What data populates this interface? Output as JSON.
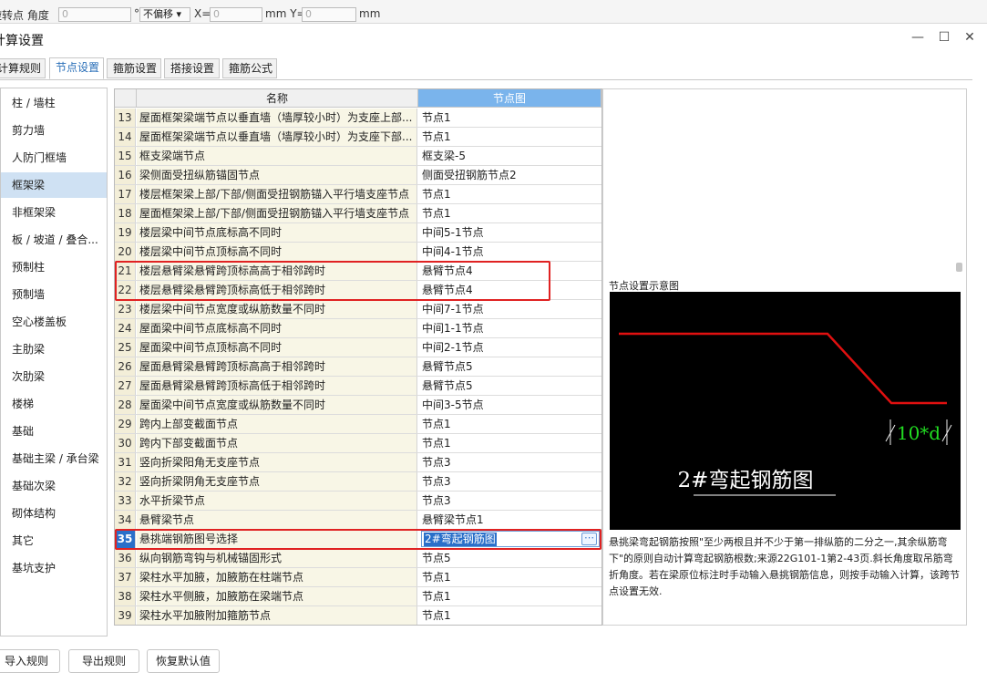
{
  "topstrip": {
    "label_rotate": "旋转点 角度",
    "angle_value": "0",
    "degree_unit": "°",
    "offset_mode": "不偏移",
    "x_label": "X=",
    "x_value": "0",
    "y_label": "mm Y=",
    "y_value": "0",
    "mm_unit": "mm"
  },
  "window": {
    "title": "计算设置",
    "minimize": "—",
    "maximize": "☐",
    "close": "✕"
  },
  "tabs": [
    {
      "label": "计算规则",
      "active": false
    },
    {
      "label": "节点设置",
      "active": true
    },
    {
      "label": "箍筋设置",
      "active": false
    },
    {
      "label": "搭接设置",
      "active": false
    },
    {
      "label": "箍筋公式",
      "active": false
    }
  ],
  "categories": [
    {
      "label": "柱 / 墙柱",
      "selected": false
    },
    {
      "label": "剪力墙",
      "selected": false
    },
    {
      "label": "人防门框墙",
      "selected": false
    },
    {
      "label": "框架梁",
      "selected": true
    },
    {
      "label": "非框架梁",
      "selected": false
    },
    {
      "label": "板 / 坡道 / 叠合...",
      "selected": false
    },
    {
      "label": "预制柱",
      "selected": false
    },
    {
      "label": "预制墙",
      "selected": false
    },
    {
      "label": "空心楼盖板",
      "selected": false
    },
    {
      "label": "主肋梁",
      "selected": false
    },
    {
      "label": "次肋梁",
      "selected": false
    },
    {
      "label": "楼梯",
      "selected": false
    },
    {
      "label": "基础",
      "selected": false
    },
    {
      "label": "基础主梁 / 承台梁",
      "selected": false
    },
    {
      "label": "基础次梁",
      "selected": false
    },
    {
      "label": "砌体结构",
      "selected": false
    },
    {
      "label": "其它",
      "selected": false
    },
    {
      "label": "基坑支护",
      "selected": false
    }
  ],
  "grid": {
    "col_name": "名称",
    "col_node": "节点图",
    "rows": [
      {
        "num": "13",
        "name": "屋面框架梁端节点以垂直墙（墙厚较小时）为支座上部...",
        "value": "节点1"
      },
      {
        "num": "14",
        "name": "屋面框架梁端节点以垂直墙（墙厚较小时）为支座下部...",
        "value": "节点1"
      },
      {
        "num": "15",
        "name": "框支梁端节点",
        "value": "框支梁-5"
      },
      {
        "num": "16",
        "name": "梁侧面受扭纵筋锚固节点",
        "value": "侧面受扭钢筋节点2"
      },
      {
        "num": "17",
        "name": "楼层框架梁上部/下部/侧面受扭钢筋锚入平行墙支座节点",
        "value": "节点1"
      },
      {
        "num": "18",
        "name": "屋面框架梁上部/下部/侧面受扭钢筋锚入平行墙支座节点",
        "value": "节点1"
      },
      {
        "num": "19",
        "name": "楼层梁中间节点底标高不同时",
        "value": "中间5-1节点"
      },
      {
        "num": "20",
        "name": "楼层梁中间节点顶标高不同时",
        "value": "中间4-1节点"
      },
      {
        "num": "21",
        "name": "楼层悬臂梁悬臂跨顶标高高于相邻跨时",
        "value": "悬臂节点4"
      },
      {
        "num": "22",
        "name": "楼层悬臂梁悬臂跨顶标高低于相邻跨时",
        "value": "悬臂节点4"
      },
      {
        "num": "23",
        "name": "楼层梁中间节点宽度或纵筋数量不同时",
        "value": "中间7-1节点"
      },
      {
        "num": "24",
        "name": "屋面梁中间节点底标高不同时",
        "value": "中间1-1节点"
      },
      {
        "num": "25",
        "name": "屋面梁中间节点顶标高不同时",
        "value": "中间2-1节点"
      },
      {
        "num": "26",
        "name": "屋面悬臂梁悬臂跨顶标高高于相邻跨时",
        "value": "悬臂节点5"
      },
      {
        "num": "27",
        "name": "屋面悬臂梁悬臂跨顶标高低于相邻跨时",
        "value": "悬臂节点5"
      },
      {
        "num": "28",
        "name": "屋面梁中间节点宽度或纵筋数量不同时",
        "value": "中间3-5节点"
      },
      {
        "num": "29",
        "name": "跨内上部变截面节点",
        "value": "节点1"
      },
      {
        "num": "30",
        "name": "跨内下部变截面节点",
        "value": "节点1"
      },
      {
        "num": "31",
        "name": "竖向折梁阳角无支座节点",
        "value": "节点3"
      },
      {
        "num": "32",
        "name": "竖向折梁阴角无支座节点",
        "value": "节点3"
      },
      {
        "num": "33",
        "name": "水平折梁节点",
        "value": "节点3"
      },
      {
        "num": "34",
        "name": "悬臂梁节点",
        "value": "悬臂梁节点1"
      },
      {
        "num": "35",
        "name": "悬挑端钢筋图号选择",
        "value": "2#弯起钢筋图"
      },
      {
        "num": "36",
        "name": "纵向钢筋弯钩与机械锚固形式",
        "value": "节点5"
      },
      {
        "num": "37",
        "name": "梁柱水平加腋，加腋筋在柱端节点",
        "value": "节点1"
      },
      {
        "num": "38",
        "name": "梁柱水平侧腋，加腋筋在梁端节点",
        "value": "节点1"
      },
      {
        "num": "39",
        "name": "梁柱水平加腋附加箍筋节点",
        "value": "节点1"
      }
    ],
    "selected_num": "35",
    "edit_button": "⋯"
  },
  "preview": {
    "title": "节点设置示意图",
    "diagram_caption": "2#弯起钢筋图",
    "dimension_label": "10*d",
    "description": "悬挑梁弯起钢筋按照\"至少两根且并不少于第一排纵筋的二分之一,其余纵筋弯下\"的原则自动计算弯起钢筋根数;来源22G101-1第2-43页.斜长角度取吊筋弯折角度。若在梁原位标注时手动输入悬挑钢筋信息，则按手动输入计算，该跨节点设置无效."
  },
  "footer": {
    "import": "导入规则",
    "export": "导出规则",
    "restore": "恢复默认值"
  },
  "colors": {
    "accent": "#2a6fc9",
    "highlight_red": "#e02222",
    "bar_red": "#e01010",
    "dim_green": "#22dd22"
  }
}
